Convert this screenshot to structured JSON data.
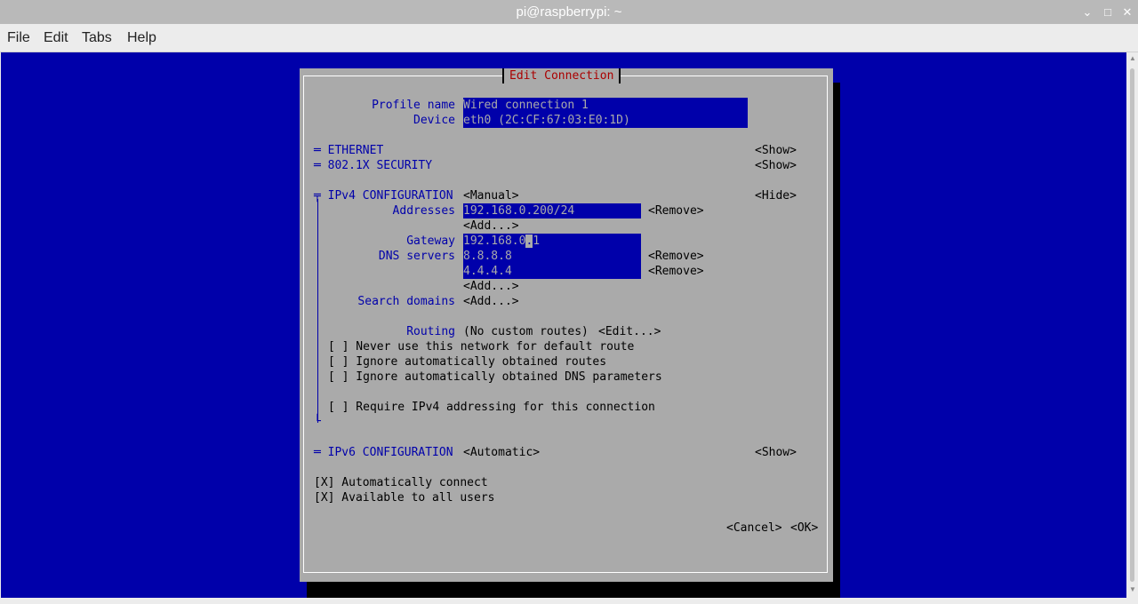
{
  "window": {
    "title": "pi@raspberrypi: ~",
    "minimize": "⌄",
    "maximize": "□",
    "close": "✕"
  },
  "menu": {
    "file": "File",
    "edit": "Edit",
    "tabs": "Tabs",
    "help": "Help"
  },
  "dialog": {
    "title": "Edit Connection",
    "profile_label": "Profile name",
    "profile_value": "Wired connection 1",
    "device_label": "Device",
    "device_value": "eth0 (2C:CF:67:03:E0:1D)",
    "ethernet": "═ ETHERNET",
    "ethernet_toggle": "<Show>",
    "security": "═ 802.1X SECURITY",
    "security_toggle": "<Show>",
    "ipv4_header": "╤ IPv4 CONFIGURATION",
    "ipv4_mode": "<Manual>",
    "ipv4_toggle": "<Hide>",
    "addresses_label": "Addresses",
    "address_1": "192.168.0.200/24",
    "remove": "<Remove>",
    "add": "<Add...>",
    "gateway_label": "Gateway",
    "gateway_pre": "192.168.0",
    "gateway_cursor": ".",
    "gateway_post": "1",
    "dns_label": "DNS servers",
    "dns_1": "8.8.8.8",
    "dns_2": "4.4.4.4",
    "search_label": "Search domains",
    "routing_label": "Routing",
    "routing_value": "(No custom routes)",
    "routing_edit": "<Edit...>",
    "cb_never_default": "[ ] Never use this network for default route",
    "cb_ignore_routes": "[ ] Ignore automatically obtained routes",
    "cb_ignore_dns": "[ ] Ignore automatically obtained DNS parameters",
    "cb_require_ipv4": "[ ] Require IPv4 addressing for this connection",
    "ipv4_end": "└",
    "ipv6_header": "═ IPv6 CONFIGURATION",
    "ipv6_mode": "<Automatic>",
    "ipv6_toggle": "<Show>",
    "cb_auto_connect": "[X] Automatically connect",
    "cb_all_users": "[X] Available to all users",
    "cancel": "<Cancel>",
    "ok": "<OK>"
  }
}
